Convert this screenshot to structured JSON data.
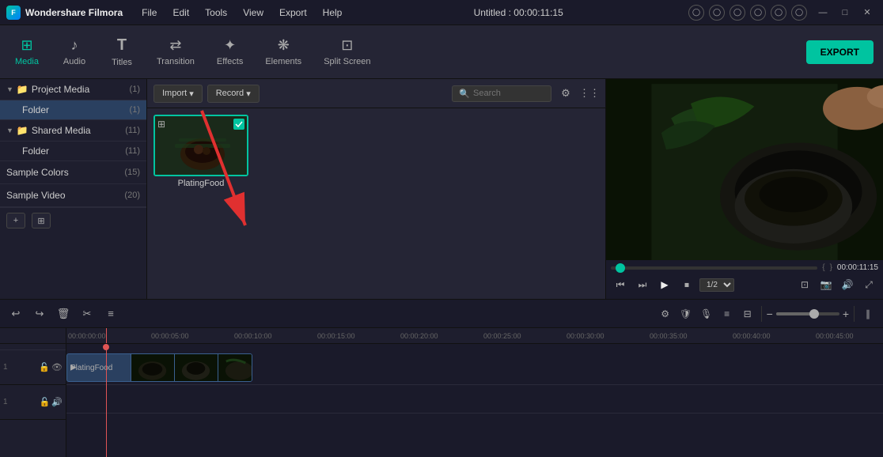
{
  "app": {
    "name": "Wondershare Filmora",
    "logo_letter": "F",
    "title": "Untitled : 00:00:11:15"
  },
  "titlebar": {
    "menu_items": [
      "File",
      "Edit",
      "Tools",
      "View",
      "Export",
      "Help"
    ],
    "win_controls": [
      "—",
      "□",
      "✕"
    ],
    "icons": [
      "○",
      "○",
      "○",
      "○",
      "○",
      "○"
    ]
  },
  "toolbar": {
    "tabs": [
      {
        "id": "media",
        "icon": "⊞",
        "label": "Media",
        "active": true
      },
      {
        "id": "audio",
        "icon": "♪",
        "label": "Audio",
        "active": false
      },
      {
        "id": "titles",
        "icon": "T",
        "label": "Titles",
        "active": false
      },
      {
        "id": "transition",
        "icon": "⇄",
        "label": "Transition",
        "active": false
      },
      {
        "id": "effects",
        "icon": "✦",
        "label": "Effects",
        "active": false
      },
      {
        "id": "elements",
        "icon": "❋",
        "label": "Elements",
        "active": false
      },
      {
        "id": "splitscreen",
        "icon": "⊡",
        "label": "Split Screen",
        "active": false
      }
    ],
    "export_label": "EXPORT"
  },
  "left_panel": {
    "sections": [
      {
        "label": "Project Media",
        "count": "1",
        "expanded": true,
        "children": [
          {
            "label": "Folder",
            "count": "1",
            "selected": true
          }
        ]
      },
      {
        "label": "Shared Media",
        "count": "11",
        "expanded": true,
        "children": [
          {
            "label": "Folder",
            "count": "11",
            "selected": false
          }
        ]
      }
    ],
    "simple_items": [
      {
        "label": "Sample Colors",
        "count": "15"
      },
      {
        "label": "Sample Video",
        "count": "20"
      }
    ],
    "footer_buttons": [
      "+",
      "⊞"
    ]
  },
  "media_panel": {
    "import_label": "Import",
    "record_label": "Record",
    "search_placeholder": "Search",
    "items": [
      {
        "name": "PlatingFood",
        "selected": true
      }
    ]
  },
  "preview": {
    "time_start": "{",
    "time_end": "}",
    "time_display": "00:00:11:15",
    "progress_pct": 0,
    "speed": "1/2",
    "controls": [
      "⏮",
      "⏭",
      "▶",
      "⏹"
    ]
  },
  "timeline": {
    "ruler_marks": [
      "00:00:00:00",
      "00:00:05:00",
      "00:00:10:00",
      "00:00:15:00",
      "00:00:20:00",
      "00:00:25:00",
      "00:00:30:00",
      "00:00:35:00",
      "00:00:40:00",
      "00:00:45:00"
    ],
    "clip_label": "PlatingFood",
    "toolbar_buttons": [
      "↩",
      "↪",
      "🗑",
      "✂",
      "≡"
    ],
    "right_buttons": [
      "⚙",
      "🛡",
      "🎙",
      "≡",
      "⊟",
      "⊕",
      "—",
      "⊞",
      "+",
      "∥"
    ]
  },
  "colors": {
    "accent": "#00c4a0",
    "bg_dark": "#1a1a2a",
    "bg_mid": "#252535",
    "bg_light": "#1e1e2e",
    "border": "#2a2a3a",
    "clip_bg": "#2a4060",
    "arrow_color": "#e03030"
  }
}
